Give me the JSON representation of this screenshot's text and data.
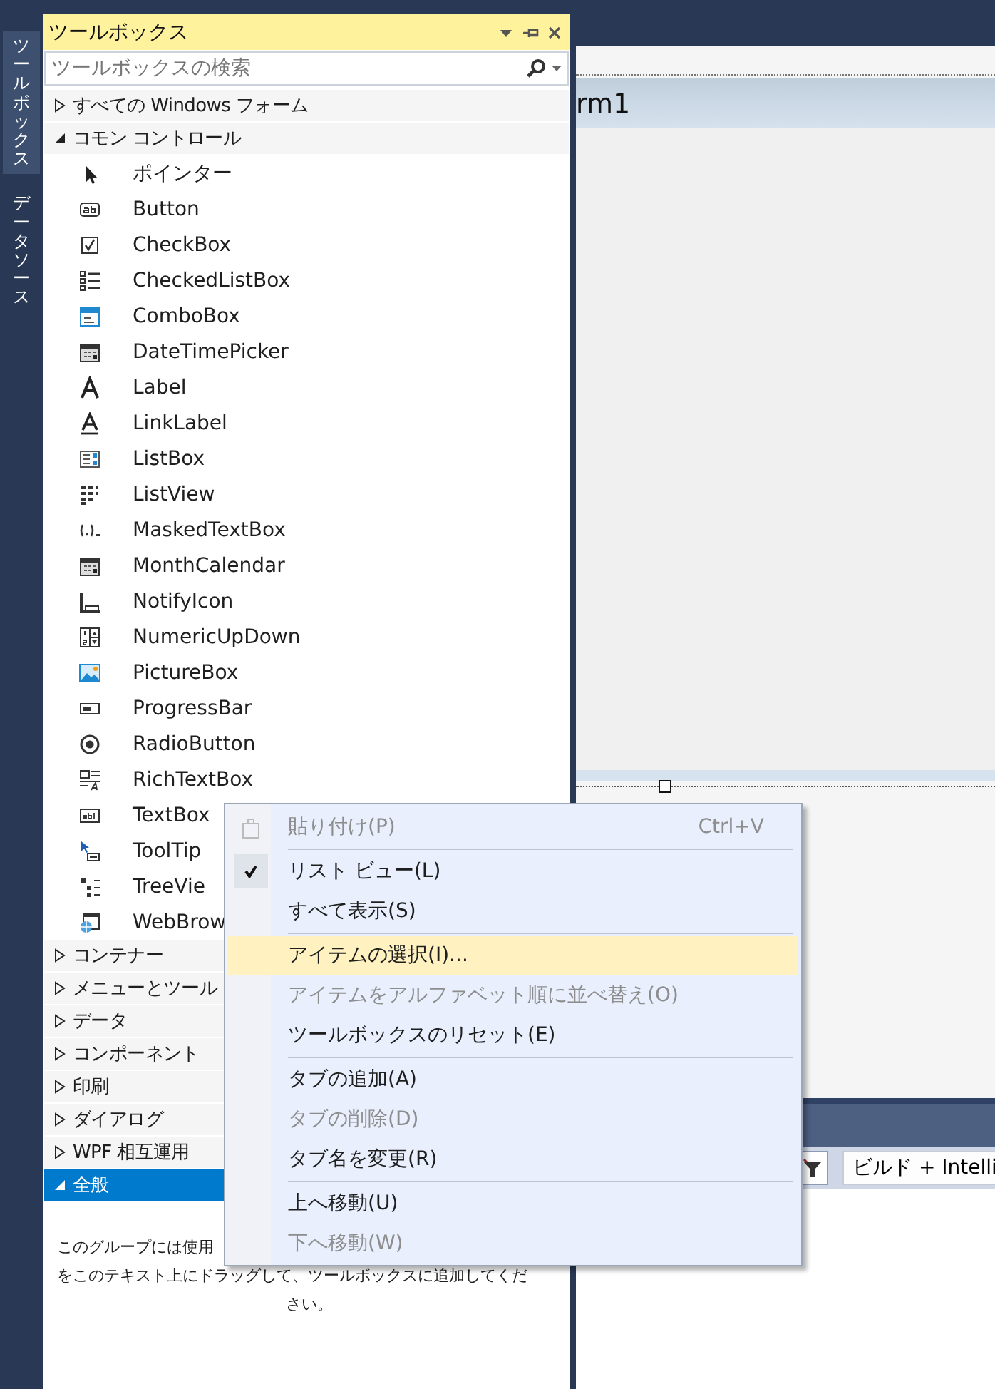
{
  "side_tabs": [
    {
      "label": "ツールボックス",
      "selected": true
    },
    {
      "label": "データソース",
      "selected": false
    }
  ],
  "toolbox": {
    "title": "ツールボックス",
    "search": {
      "placeholder": "ツールボックスの検索"
    },
    "groups": [
      {
        "label": "すべての Windows フォーム",
        "expanded": false,
        "selected": false
      },
      {
        "label": "コモン コントロール",
        "expanded": true,
        "selected": false,
        "children": [
          {
            "label": "ポインター",
            "kind": "pointer"
          },
          {
            "label": "Button",
            "kind": "button"
          },
          {
            "label": "CheckBox",
            "kind": "checkbox"
          },
          {
            "label": "CheckedListBox",
            "kind": "checklist"
          },
          {
            "label": "ComboBox",
            "kind": "combo"
          },
          {
            "label": "DateTimePicker",
            "kind": "calendar"
          },
          {
            "label": "Label",
            "kind": "letter"
          },
          {
            "label": "LinkLabel",
            "kind": "linkletter"
          },
          {
            "label": "ListBox",
            "kind": "listbox"
          },
          {
            "label": "ListView",
            "kind": "grid"
          },
          {
            "label": "MaskedTextBox",
            "kind": "mask"
          },
          {
            "label": "MonthCalendar",
            "kind": "calendar"
          },
          {
            "label": "NotifyIcon",
            "kind": "tray"
          },
          {
            "label": "NumericUpDown",
            "kind": "numeric"
          },
          {
            "label": "PictureBox",
            "kind": "picture"
          },
          {
            "label": "ProgressBar",
            "kind": "progress"
          },
          {
            "label": "RadioButton",
            "kind": "radio"
          },
          {
            "label": "RichTextBox",
            "kind": "richtext"
          },
          {
            "label": "TextBox",
            "kind": "textbox"
          },
          {
            "label": "ToolTip",
            "kind": "tooltip"
          },
          {
            "label": "TreeVie",
            "kind": "tree"
          },
          {
            "label": "WebBrow",
            "kind": "globe"
          }
        ]
      },
      {
        "label": "コンテナー",
        "expanded": false,
        "selected": false
      },
      {
        "label": "メニューとツール",
        "expanded": false,
        "selected": false
      },
      {
        "label": "データ",
        "expanded": false,
        "selected": false
      },
      {
        "label": "コンポーネント",
        "expanded": false,
        "selected": false
      },
      {
        "label": "印刷",
        "expanded": false,
        "selected": false
      },
      {
        "label": "ダイアログ",
        "expanded": false,
        "selected": false
      },
      {
        "label": "WPF 相互運用",
        "expanded": false,
        "selected": false
      },
      {
        "label": "全般",
        "expanded": true,
        "selected": true,
        "note_lines": [
          "このグループには使用",
          "をこのテキスト上にドラッグして、ツールボックスに追加してくだ",
          "さい。"
        ]
      }
    ]
  },
  "designer": {
    "form_title": "rm1"
  },
  "output": {
    "build_filter": "ビルド + Intelli"
  },
  "context_menu": {
    "items": [
      {
        "kind": "item",
        "label": "貼り付け(P)",
        "shortcut": "Ctrl+V",
        "disabled": true,
        "checked": false,
        "highlighted": false
      },
      {
        "kind": "separator"
      },
      {
        "kind": "item",
        "label": "リスト ビュー(L)",
        "disabled": false,
        "checked": true,
        "highlighted": false
      },
      {
        "kind": "item",
        "label": "すべて表示(S)",
        "disabled": false,
        "checked": false,
        "highlighted": false
      },
      {
        "kind": "separator"
      },
      {
        "kind": "item",
        "label": "アイテムの選択(I)...",
        "disabled": false,
        "checked": false,
        "highlighted": true
      },
      {
        "kind": "item",
        "label": "アイテムをアルファベット順に並べ替え(O)",
        "disabled": true,
        "checked": false,
        "highlighted": false
      },
      {
        "kind": "item",
        "label": "ツールボックスのリセット(E)",
        "disabled": false,
        "checked": false,
        "highlighted": false
      },
      {
        "kind": "separator"
      },
      {
        "kind": "item",
        "label": "タブの追加(A)",
        "disabled": false,
        "checked": false,
        "highlighted": false
      },
      {
        "kind": "item",
        "label": "タブの削除(D)",
        "disabled": true,
        "checked": false,
        "highlighted": false
      },
      {
        "kind": "item",
        "label": "タブ名を変更(R)",
        "disabled": false,
        "checked": false,
        "highlighted": false
      },
      {
        "kind": "separator"
      },
      {
        "kind": "item",
        "label": "上へ移動(U)",
        "disabled": false,
        "checked": false,
        "highlighted": false
      },
      {
        "kind": "item",
        "label": "下へ移動(W)",
        "disabled": true,
        "checked": false,
        "highlighted": false
      }
    ]
  }
}
